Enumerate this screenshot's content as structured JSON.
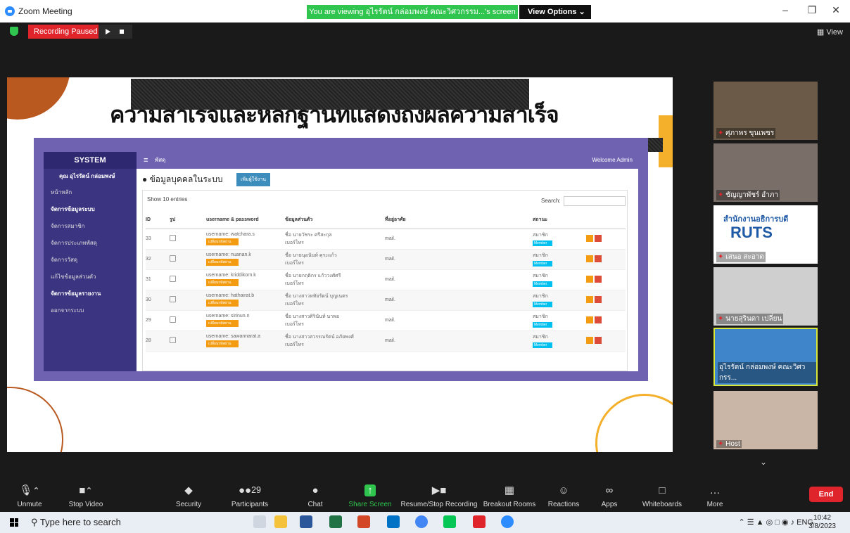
{
  "window": {
    "title": "Zoom Meeting",
    "banner": "You are viewing อุไรรัตน์ กล่อมพงษ์ คณะวิศวกรรม...'s screen",
    "view_options": "View Options",
    "view_label": "View"
  },
  "recording": {
    "status": "Recording Paused"
  },
  "slide": {
    "heading": "ความสำเร็จและหลักฐานที่แสดงถึงผลความสำเร็จ",
    "app": {
      "brand": "SYSTEM",
      "breadcrumb": "พัสดุ",
      "welcome": "Welcome Admin",
      "user": "คุณ อุไรรัตน์ กล่อมพงษ์",
      "sidebar": [
        "หน้าหลัก",
        "จัดการข้อมูลระบบ",
        "จัดการสมาชิก",
        "จัดการประเภทพัสดุ",
        "จัดการวัสดุ",
        "แก้ไขข้อมูลส่วนตัว",
        "จัดการข้อมูลรายงาน",
        "ออกจากระบบ"
      ],
      "page_title": "ข้อมูลบุคคลในระบบ",
      "add_button": "เพิ่มผู้ใช้งาน",
      "show_label": "Show",
      "show_value": "10",
      "entries_label": "entries",
      "search_label": "Search:",
      "columns": [
        "ID",
        "รูป",
        "username & password",
        "ข้อมูลส่วนตัว",
        "ที่อยู่อาศัย",
        "สถานะ",
        ""
      ],
      "rows": [
        {
          "id": "33",
          "user": "username: watchara.s",
          "pw": "เปลี่ยนรหัสผ่าน",
          "name": "ชื่อ นายวัชระ ศรีสะกุล",
          "phone": "เบอร์โทร",
          "addr": "mail.",
          "status": "สมาชิก",
          "badge": "Member"
        },
        {
          "id": "32",
          "user": "username: nuanan.k",
          "pw": "เปลี่ยนรหัสผ่าน",
          "name": "ชื่อ นายนุอนันท์ คุระแก้ว",
          "phone": "เบอร์โทร",
          "addr": "mail.",
          "status": "สมาชิก",
          "badge": "Member"
        },
        {
          "id": "31",
          "user": "username: kriddikorn.k",
          "pw": "เปลี่ยนรหัสผ่าน",
          "name": "ชื่อ นายกฤติกร แก้ววงศ์ศรี",
          "phone": "เบอร์โทร",
          "addr": "mail.",
          "status": "สมาชิก",
          "badge": "Member"
        },
        {
          "id": "30",
          "user": "username: hathairat.b",
          "pw": "เปลี่ยนรหัสผ่าน",
          "name": "ชื่อ นางสาวหทัยรัตน์ บุญเนตร",
          "phone": "เบอร์โทร",
          "addr": "mail.",
          "status": "สมาชิก",
          "badge": "Member"
        },
        {
          "id": "29",
          "user": "username: sirinun.n",
          "pw": "เปลี่ยนรหัสผ่าน",
          "name": "ชื่อ นางสาวศิรินันท์ นาพอ",
          "phone": "เบอร์โทร",
          "addr": "mail.",
          "status": "สมาชิก",
          "badge": "Member"
        },
        {
          "id": "28",
          "user": "username: sawannarat.a",
          "pw": "เปลี่ยนรหัสผ่าน",
          "name": "ชื่อ นางสาวสวรรณรัตน์ อภัยพงศ์",
          "phone": "เบอร์โทร",
          "addr": "mail.",
          "status": "สมาชิก",
          "badge": "Member"
        }
      ]
    }
  },
  "participants": [
    {
      "name": "ศุภาพร ขุนเพชร",
      "color": "#6b5a48"
    },
    {
      "name": "ชัญญาพัชร์ อำภา",
      "color": "#7a6e68"
    },
    {
      "name": "เสนอ สะอาด",
      "color": "#3d6fa8",
      "logo": "สำนักงานอธิการบดี",
      "logo2": "RUTS"
    },
    {
      "name": "นายสุรินดา เปลี่ยน",
      "color": "#cfcfcf"
    },
    {
      "name": "อุไรรัตน์ กล่อมพงษ์ คณะวิศวกรร...",
      "color": "#3e86c9"
    },
    {
      "name": "Host",
      "color": "#c9b6a6"
    }
  ],
  "toolbar": {
    "unmute": "Unmute",
    "stop_video": "Stop Video",
    "security": "Security",
    "participants": "Participants",
    "participants_count": "29",
    "chat": "Chat",
    "share_screen": "Share Screen",
    "resume_recording": "Resume/Stop Recording",
    "breakout_rooms": "Breakout Rooms",
    "reactions": "Reactions",
    "apps": "Apps",
    "whiteboards": "Whiteboards",
    "more": "More",
    "end": "End"
  },
  "taskbar": {
    "search_placeholder": "Type here to search",
    "lang": "ENG",
    "time": "10:42",
    "date": "3/8/2023"
  },
  "colors": {
    "accent": "#2d8cff",
    "end": "#e0242b",
    "share": "#2fc54e"
  }
}
